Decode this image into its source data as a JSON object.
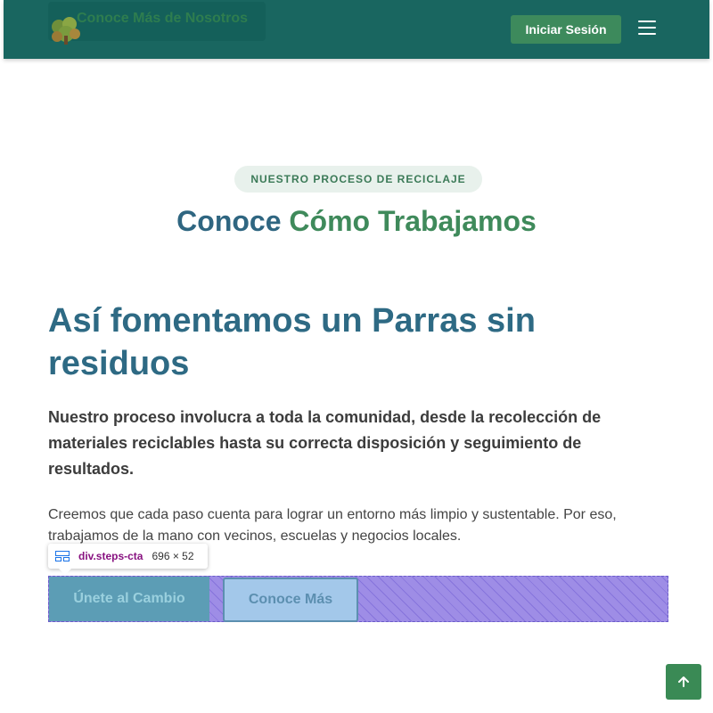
{
  "navbar": {
    "ghost_button_label": "Conoce Más de Nosotros",
    "logo_icon": "tree-logo-icon",
    "login_label": "Iniciar Sesión",
    "menu_icon": "hamburger-menu-icon"
  },
  "section": {
    "badge": "NUESTRO PROCESO DE RECICLAJE",
    "title_part1": "Conoce",
    "title_part2": "Cómo Trabajamos"
  },
  "content": {
    "heading": "Así fomentamos un Parras sin residuos",
    "lead": "Nuestro proceso involucra a toda la comunidad, desde la recolección de materiales reciclables hasta su correcta disposición y seguimiento de resultados.",
    "body": "Creemos que cada paso cuenta para lograr un entorno más limpio y sustentable. Por eso, trabajamos de la mano con vecinos, escuelas y negocios locales."
  },
  "cta": {
    "primary_label": "Únete al Cambio",
    "secondary_label": "Conoce Más"
  },
  "inspector": {
    "selector": "div.steps-cta",
    "dimensions": "696 × 52",
    "icon": "flex-layout-icon"
  },
  "back_to_top": {
    "icon": "arrow-up-icon"
  },
  "colors": {
    "navbar_bg": "#196660",
    "accent_green": "#3d8a5c",
    "title_blue": "#2f6681",
    "highlight_purple": "#9e8de6"
  }
}
